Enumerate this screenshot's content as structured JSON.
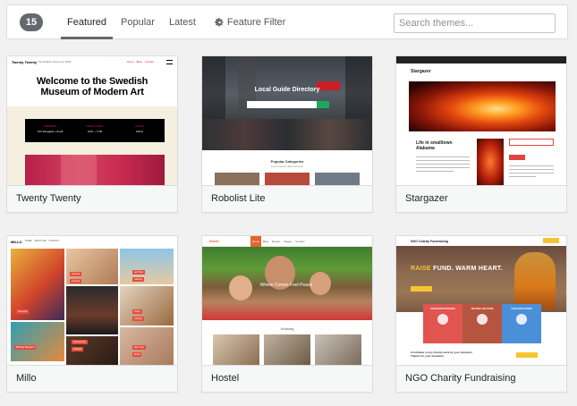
{
  "filter_bar": {
    "count": "15",
    "tabs": [
      {
        "label": "Featured",
        "current": true
      },
      {
        "label": "Popular",
        "current": false
      },
      {
        "label": "Latest",
        "current": false
      }
    ],
    "feature_filter_label": "Feature Filter",
    "feature_filter_icon": "gear-icon",
    "search_placeholder": "Search themes..."
  },
  "themes": [
    {
      "name": "Twenty Twenty",
      "screenshot": {
        "site_title": "Twenty Twenty",
        "site_desc": "The Default Theme for 2020",
        "menu": [
          "About",
          "Blog",
          "Contact"
        ],
        "headline_1": "Welcome to the Swedish",
        "headline_2": "Museum of Modern Art",
        "info": [
          {
            "label": "ADDRESS",
            "value": "123 Storgatan, Umeå"
          },
          {
            "label": "OPEN TODAY",
            "value": "9:00 — 5:00"
          },
          {
            "label": "PRICE",
            "value": "129 kr"
          }
        ]
      }
    },
    {
      "name": "Robolist Lite",
      "screenshot": {
        "hero_title": "Local Guide Directory",
        "categories_title": "Popular Categories",
        "categories_sub": "Lorem ipsum dolor sit amet"
      }
    },
    {
      "name": "Stargazer",
      "screenshot": {
        "site_title": "Stargazer",
        "post_title": "Life in smalltown Alabama"
      }
    },
    {
      "name": "Millo",
      "screenshot": {
        "logo": "MILLO",
        "menu": [
          "HOME",
          "ABOUT ME",
          "CONTACT"
        ],
        "tags": [
          "Street Art",
          "Birthday Weekend",
          "Lifestyle",
          "Lifestyle",
          "Tranquil Life",
          "Lifestyle",
          "Lifestyle",
          "Lifestyle",
          "April Sun",
          "Teddy",
          "New Year",
          "Bridal"
        ]
      }
    },
    {
      "name": "Hostel",
      "screenshot": {
        "logo": "Hostel",
        "menu": [
          "Home",
          "Blog",
          "Rooms",
          "Pages",
          "Contact"
        ],
        "caption": "Where Comes Feel Peace",
        "section_heading": "Housing"
      }
    },
    {
      "name": "NGO Charity Fundraising",
      "screenshot": {
        "site_title": "NGO Charity Fundraising",
        "headline_prefix": "RAISE",
        "headline_rest": " FUND. WARM HEART.",
        "boxes": [
          "DONATION PROGRAM",
          "HELPING THE POOR",
          "CHILD EDUCATION"
        ],
        "box_colors": [
          "#e1544f",
          "#b5553f",
          "#4a90d9"
        ],
        "bottom_text": "Contribute on my charity work by your donation. Thanks for your donation!"
      }
    }
  ],
  "colors": {
    "accent": "#646970",
    "twenty_twenty_accent": "#cd2653",
    "robolist_green": "#1ea85b",
    "hostel_orange": "#e0672d",
    "ngo_yellow": "#f7c431"
  }
}
